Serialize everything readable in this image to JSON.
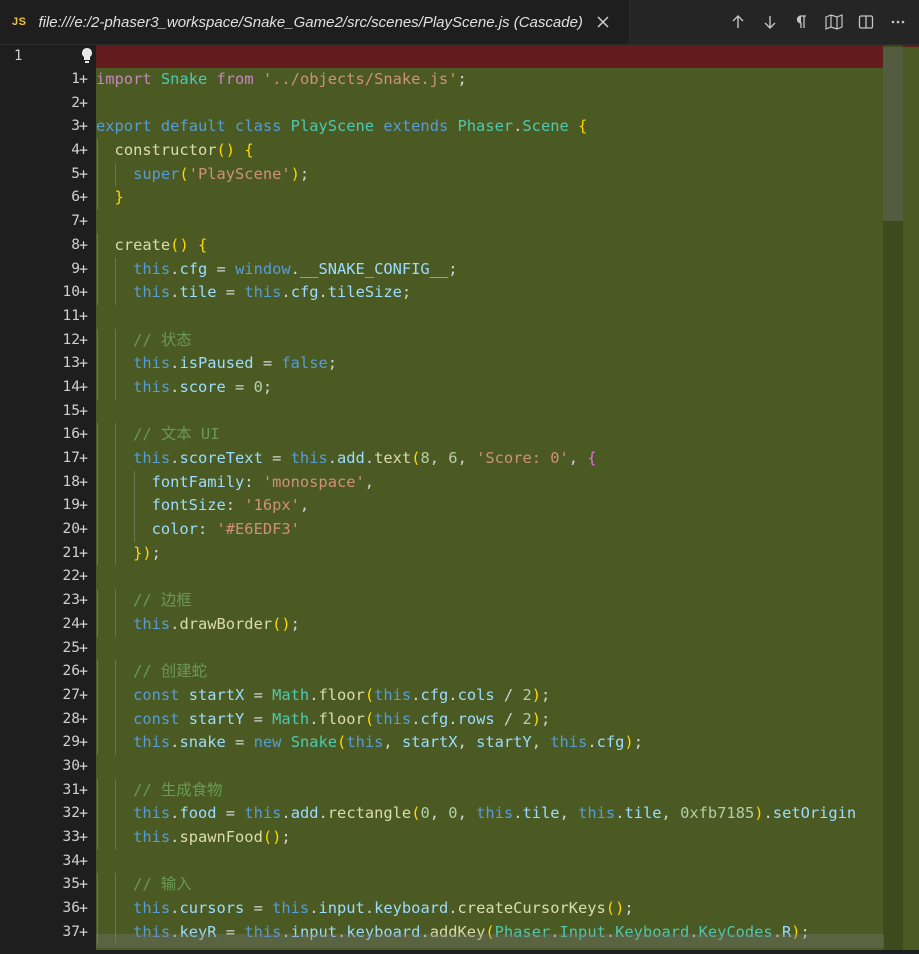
{
  "tab": {
    "lang_badge": "JS",
    "title": "file:///e:/2-phaser3_workspace/Snake_Game2/src/scenes/PlayScene.js (Cascade)"
  },
  "toolbar": {
    "icons": [
      "arrow-up-icon",
      "arrow-down-icon",
      "pilcrow-icon",
      "book-open-icon",
      "split-editor-icon",
      "more-icon"
    ]
  },
  "original": {
    "line_number": "1"
  },
  "diff_marker": "+",
  "code_lines": [
    {
      "n": "1",
      "t": "import Snake from '../objects/Snake.js';"
    },
    {
      "n": "2",
      "t": ""
    },
    {
      "n": "3",
      "t": "export default class PlayScene extends Phaser.Scene {"
    },
    {
      "n": "4",
      "t": "  constructor() {"
    },
    {
      "n": "5",
      "t": "    super('PlayScene');"
    },
    {
      "n": "6",
      "t": "  }"
    },
    {
      "n": "7",
      "t": ""
    },
    {
      "n": "8",
      "t": "  create() {"
    },
    {
      "n": "9",
      "t": "    this.cfg = window.__SNAKE_CONFIG__;"
    },
    {
      "n": "10",
      "t": "    this.tile = this.cfg.tileSize;"
    },
    {
      "n": "11",
      "t": ""
    },
    {
      "n": "12",
      "t": "    // 状态"
    },
    {
      "n": "13",
      "t": "    this.isPaused = false;"
    },
    {
      "n": "14",
      "t": "    this.score = 0;"
    },
    {
      "n": "15",
      "t": ""
    },
    {
      "n": "16",
      "t": "    // 文本 UI"
    },
    {
      "n": "17",
      "t": "    this.scoreText = this.add.text(8, 6, 'Score: 0', {"
    },
    {
      "n": "18",
      "t": "      fontFamily: 'monospace',"
    },
    {
      "n": "19",
      "t": "      fontSize: '16px',"
    },
    {
      "n": "20",
      "t": "      color: '#E6EDF3'"
    },
    {
      "n": "21",
      "t": "    });"
    },
    {
      "n": "22",
      "t": ""
    },
    {
      "n": "23",
      "t": "    // 边框"
    },
    {
      "n": "24",
      "t": "    this.drawBorder();"
    },
    {
      "n": "25",
      "t": ""
    },
    {
      "n": "26",
      "t": "    // 创建蛇"
    },
    {
      "n": "27",
      "t": "    const startX = Math.floor(this.cfg.cols / 2);"
    },
    {
      "n": "28",
      "t": "    const startY = Math.floor(this.cfg.rows / 2);"
    },
    {
      "n": "29",
      "t": "    this.snake = new Snake(this, startX, startY, this.cfg);"
    },
    {
      "n": "30",
      "t": ""
    },
    {
      "n": "31",
      "t": "    // 生成食物"
    },
    {
      "n": "32",
      "t": "    this.food = this.add.rectangle(0, 0, this.tile, this.tile, 0xfb7185).setOrigin"
    },
    {
      "n": "33",
      "t": "    this.spawnFood();"
    },
    {
      "n": "34",
      "t": ""
    },
    {
      "n": "35",
      "t": "    // 输入"
    },
    {
      "n": "36",
      "t": "    this.cursors = this.input.keyboard.createCursorKeys();"
    },
    {
      "n": "37",
      "t": "    this.keyR = this.input.keyboard.addKey(Phaser.Input.Keyboard.KeyCodes.R);"
    }
  ],
  "colors": {
    "added_bg": "#4b5a23",
    "removed_bg": "#631c1e",
    "editor_bg": "#1e1e1e",
    "js_badge": "#f0c24a"
  }
}
